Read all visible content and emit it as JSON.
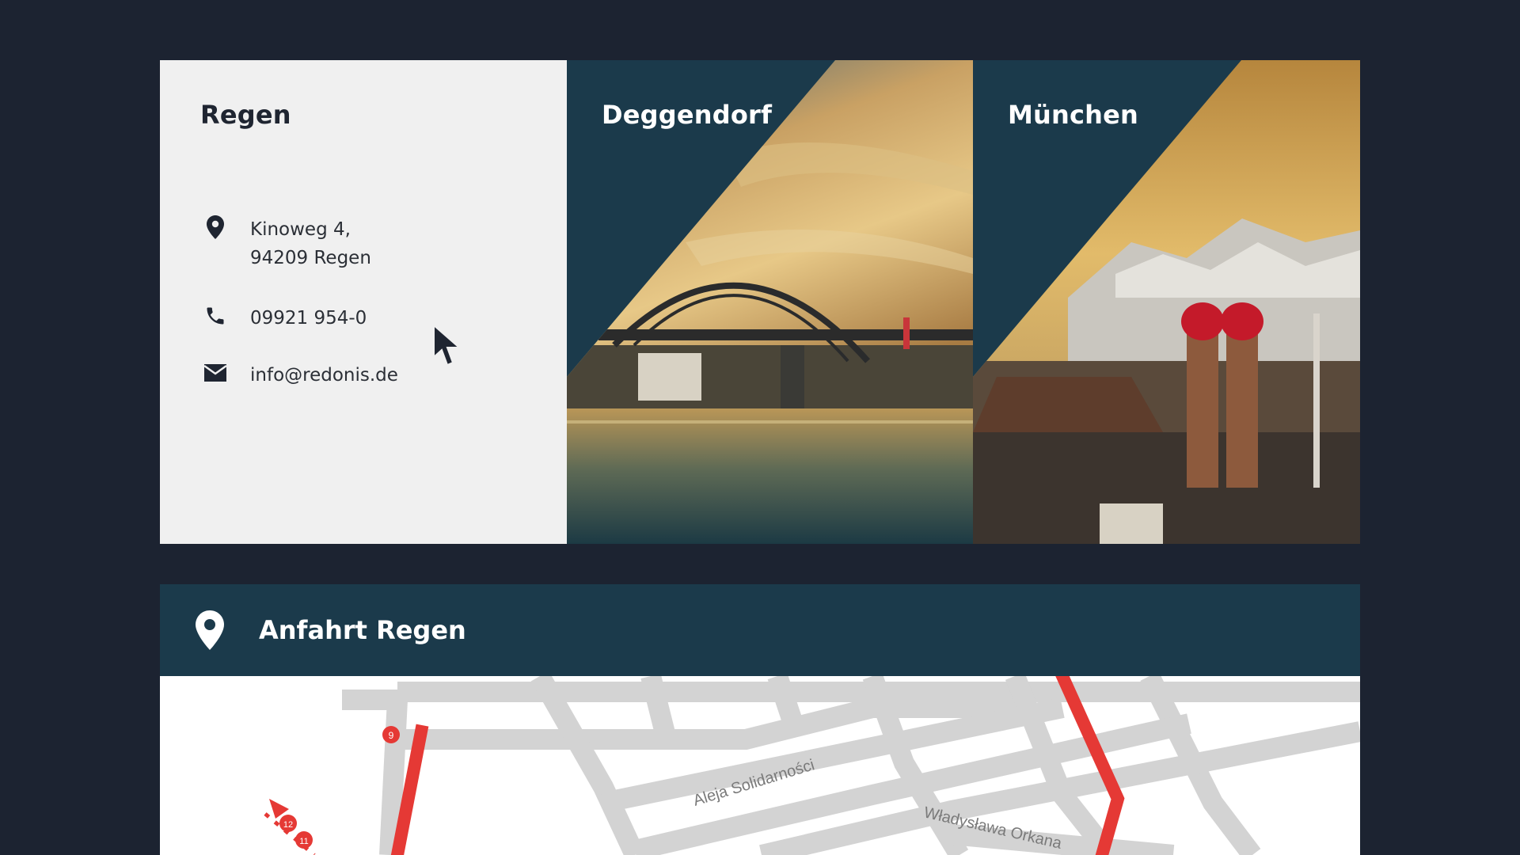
{
  "locations": [
    {
      "title": "Regen",
      "address_line1": "Kinoweg 4,",
      "address_line2": "94209 Regen",
      "phone": "09921 954-0",
      "email": "info@redonis.de"
    },
    {
      "title": "Deggendorf"
    },
    {
      "title": "München"
    }
  ],
  "anfahrt": {
    "title": "Anfahrt Regen",
    "icon": "location-pin-icon"
  },
  "map": {
    "street_labels": [
      "Aleja Solidarności",
      "Władysława Orkana"
    ],
    "markers": [
      "9",
      "12",
      "11"
    ]
  },
  "colors": {
    "background": "#1c2331",
    "accent_dark": "#1b3a4b",
    "card_light": "#f0f0f0",
    "route": "#e53935"
  }
}
